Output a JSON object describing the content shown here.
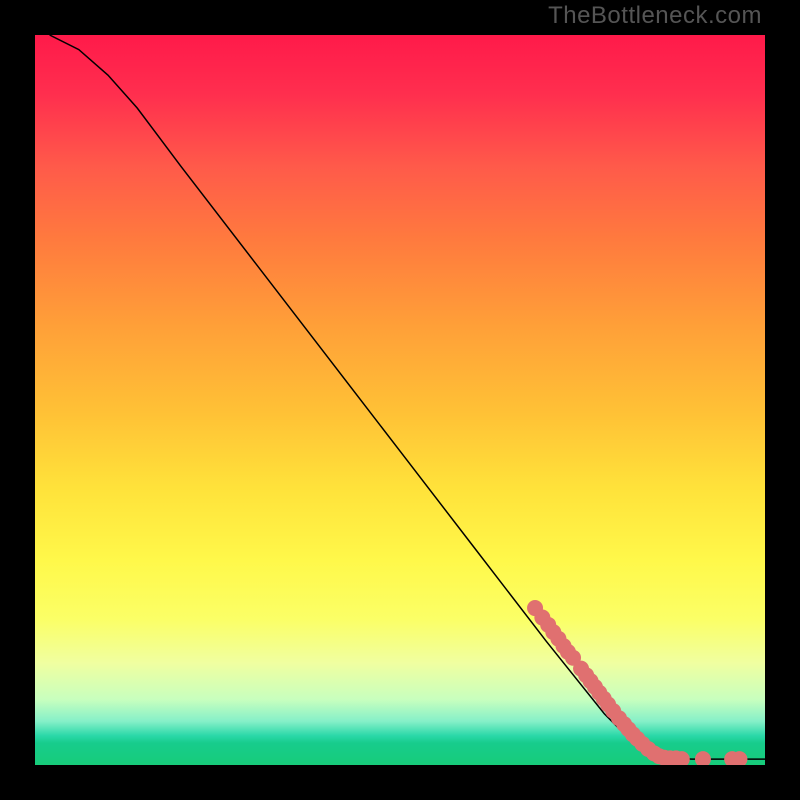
{
  "watermark": "TheBottleneck.com",
  "chart_data": {
    "type": "line",
    "title": "",
    "xlabel": "",
    "ylabel": "",
    "xlim": [
      0,
      100
    ],
    "ylim": [
      0,
      100
    ],
    "curve": [
      {
        "x": 2,
        "y": 100
      },
      {
        "x": 6,
        "y": 98
      },
      {
        "x": 10,
        "y": 94.5
      },
      {
        "x": 14,
        "y": 90
      },
      {
        "x": 20,
        "y": 82
      },
      {
        "x": 30,
        "y": 69
      },
      {
        "x": 40,
        "y": 56
      },
      {
        "x": 50,
        "y": 43
      },
      {
        "x": 60,
        "y": 30
      },
      {
        "x": 70,
        "y": 17
      },
      {
        "x": 78,
        "y": 7
      },
      {
        "x": 82,
        "y": 3
      },
      {
        "x": 86,
        "y": 1
      },
      {
        "x": 90,
        "y": 0.8
      },
      {
        "x": 95,
        "y": 0.8
      },
      {
        "x": 100,
        "y": 0.8
      }
    ],
    "markers": [
      {
        "x": 68.5,
        "y": 21.5
      },
      {
        "x": 69.5,
        "y": 20.2
      },
      {
        "x": 70.3,
        "y": 19.2
      },
      {
        "x": 71.0,
        "y": 18.2
      },
      {
        "x": 71.7,
        "y": 17.3
      },
      {
        "x": 72.4,
        "y": 16.3
      },
      {
        "x": 73.0,
        "y": 15.5
      },
      {
        "x": 73.7,
        "y": 14.7
      },
      {
        "x": 74.8,
        "y": 13.2
      },
      {
        "x": 75.5,
        "y": 12.3
      },
      {
        "x": 76.1,
        "y": 11.5
      },
      {
        "x": 76.7,
        "y": 10.7
      },
      {
        "x": 77.3,
        "y": 9.9
      },
      {
        "x": 77.9,
        "y": 9.1
      },
      {
        "x": 78.5,
        "y": 8.3
      },
      {
        "x": 79.2,
        "y": 7.4
      },
      {
        "x": 80.0,
        "y": 6.4
      },
      {
        "x": 80.7,
        "y": 5.6
      },
      {
        "x": 81.3,
        "y": 4.9
      },
      {
        "x": 81.9,
        "y": 4.2
      },
      {
        "x": 82.5,
        "y": 3.6
      },
      {
        "x": 83.2,
        "y": 2.9
      },
      {
        "x": 84.0,
        "y": 2.2
      },
      {
        "x": 84.8,
        "y": 1.6
      },
      {
        "x": 85.5,
        "y": 1.2
      },
      {
        "x": 86.2,
        "y": 1.0
      },
      {
        "x": 87.0,
        "y": 0.9
      },
      {
        "x": 87.8,
        "y": 0.9
      },
      {
        "x": 88.6,
        "y": 0.8
      },
      {
        "x": 91.5,
        "y": 0.8
      },
      {
        "x": 95.5,
        "y": 0.8
      },
      {
        "x": 96.5,
        "y": 0.8
      }
    ],
    "marker_color": "#e07070",
    "marker_radius_px": 8
  }
}
